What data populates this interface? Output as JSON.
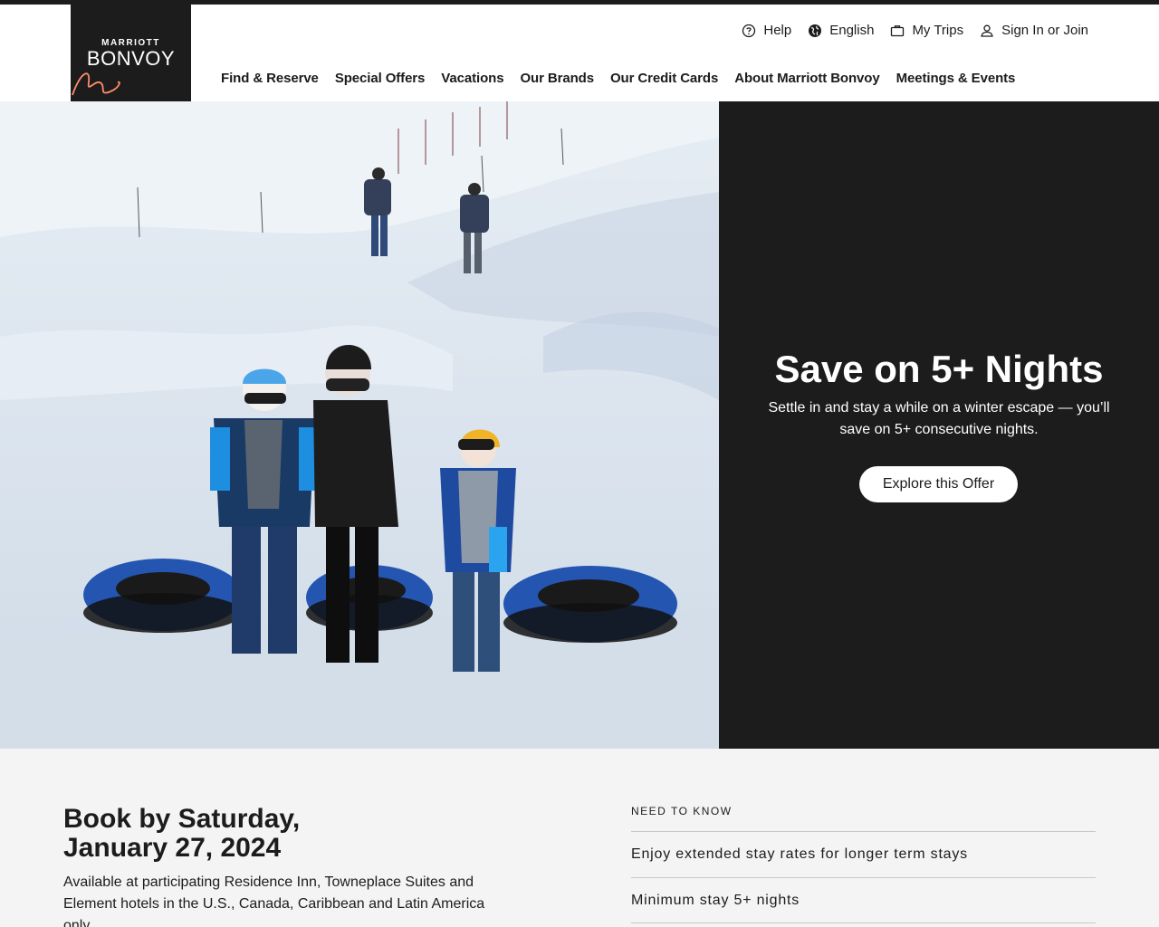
{
  "header": {
    "logo_small": "MARRIOTT",
    "logo_big": "BONVOY",
    "utility": {
      "help": "Help",
      "language": "English",
      "trips": "My Trips",
      "signin": "Sign In or Join"
    },
    "nav": [
      "Find & Reserve",
      "Special Offers",
      "Vacations",
      "Our Brands",
      "Our Credit Cards",
      "About Marriott Bonvoy",
      "Meetings & Events"
    ]
  },
  "hero": {
    "title": "Save on 5+ Nights",
    "description": "Settle in and stay a while on a winter escape — you’ll save on 5+ consecutive nights.",
    "button": "Explore this Offer"
  },
  "offer": {
    "book_by_line1": "Book by Saturday,",
    "book_by_line2": "January 27, 2024",
    "description": "Available at participating Residence Inn, Towneplace Suites and Element hotels in the U.S., Canada, Caribbean and Latin America only."
  },
  "need_to_know": {
    "label": "NEED TO KNOW",
    "items": [
      "Enjoy extended stay rates for longer term stays",
      "Minimum stay 5+ nights"
    ]
  },
  "colors": {
    "dark": "#1c1c1c",
    "accent": "#ff8d6b",
    "light_bg": "#f4f4f4"
  }
}
